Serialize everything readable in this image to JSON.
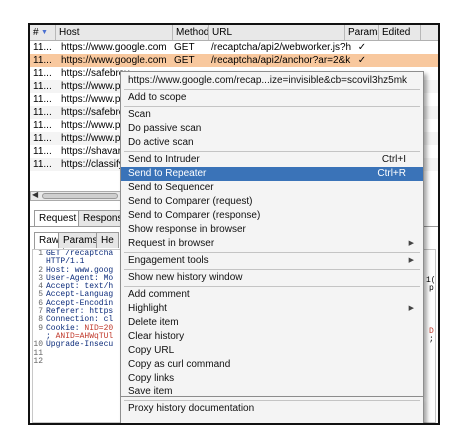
{
  "table": {
    "sort_arrow": "▼",
    "columns": [
      "#",
      "Host",
      "Method",
      "URL",
      "Params",
      "Edited"
    ],
    "rows": [
      {
        "num": "11...",
        "host": "https://www.google.com",
        "method": "GET",
        "url": "/recaptcha/api2/webworker.js?hl...",
        "params": "✓"
      },
      {
        "num": "11...",
        "host": "https://www.google.com",
        "method": "GET",
        "url": "/recaptcha/api2/anchor?ar=2&k...",
        "params": "✓"
      },
      {
        "num": "11...",
        "host": "https://safebrov",
        "method": "",
        "url": "",
        "params": ""
      },
      {
        "num": "11...",
        "host": "https://www.pin",
        "method": "",
        "url": "",
        "params": ""
      },
      {
        "num": "11...",
        "host": "https://www.pin",
        "method": "",
        "url": "",
        "params": ""
      },
      {
        "num": "11...",
        "host": "https://safebrov",
        "method": "",
        "url": "",
        "params": ""
      },
      {
        "num": "11...",
        "host": "https://www.pin",
        "method": "",
        "url": "",
        "params": ""
      },
      {
        "num": "11...",
        "host": "https://www.pin",
        "method": "",
        "url": "",
        "params": ""
      },
      {
        "num": "11...",
        "host": "https://shavar.s",
        "method": "",
        "url": "",
        "params": ""
      },
      {
        "num": "11...",
        "host": "https://classify-",
        "method": "",
        "url": "",
        "params": ""
      }
    ]
  },
  "tabs": {
    "outer": [
      "Request",
      "Response"
    ],
    "inner": [
      "Raw",
      "Params",
      "He"
    ]
  },
  "editor": {
    "line_numbers": [
      "1",
      "2",
      "3",
      "4",
      "5",
      "6",
      "7",
      "8",
      "9",
      "10",
      "11",
      "12"
    ],
    "lines": [
      "GET /recaptcha",
      "HTTP/1.1",
      "Host: www.goog",
      "User-Agent: Mo",
      "Accept: text/h",
      "Accept-Languag",
      "Accept-Encodin",
      "Referer: https",
      "Connection: cl",
      "Cookie: NID=20",
      "; ANID=AHWqTUl",
      "Upgrade-Insecu",
      "",
      ""
    ],
    "cookie_prefix": "Cookie: ",
    "cookie_value": "NID=20",
    "anid_prefix": "; ",
    "anid_value": "ANID=AHWqTUl",
    "right_fragments": [
      "1(",
      "p",
      "D",
      ";"
    ]
  },
  "context_menu": {
    "items": [
      {
        "label": "https://www.google.com/recap...ize=invisible&cb=scovil3hz5mk",
        "shortcut": "",
        "submenu": false
      },
      {
        "label": "Add to scope",
        "shortcut": "",
        "submenu": false
      },
      {
        "label": "Scan",
        "shortcut": "",
        "submenu": false
      },
      {
        "label": "Do passive scan",
        "shortcut": "",
        "submenu": false
      },
      {
        "label": "Do active scan",
        "shortcut": "",
        "submenu": false
      },
      {
        "label": "Send to Intruder",
        "shortcut": "Ctrl+I",
        "submenu": false
      },
      {
        "label": "Send to Repeater",
        "shortcut": "Ctrl+R",
        "submenu": false,
        "highlighted": true
      },
      {
        "label": "Send to Sequencer",
        "shortcut": "",
        "submenu": false
      },
      {
        "label": "Send to Comparer (request)",
        "shortcut": "",
        "submenu": false
      },
      {
        "label": "Send to Comparer (response)",
        "shortcut": "",
        "submenu": false
      },
      {
        "label": "Show response in browser",
        "shortcut": "",
        "submenu": false
      },
      {
        "label": "Request in browser",
        "shortcut": "",
        "submenu": true
      },
      {
        "label": "Engagement tools",
        "shortcut": "",
        "submenu": true
      },
      {
        "label": "Show new history window",
        "shortcut": "",
        "submenu": false
      },
      {
        "label": "Add comment",
        "shortcut": "",
        "submenu": false
      },
      {
        "label": "Highlight",
        "shortcut": "",
        "submenu": true
      },
      {
        "label": "Delete item",
        "shortcut": "",
        "submenu": false
      },
      {
        "label": "Clear history",
        "shortcut": "",
        "submenu": false
      },
      {
        "label": "Copy URL",
        "shortcut": "",
        "submenu": false
      },
      {
        "label": "Copy as curl command",
        "shortcut": "",
        "submenu": false
      },
      {
        "label": "Copy links",
        "shortcut": "",
        "submenu": false
      },
      {
        "label": "Save item",
        "shortcut": "",
        "submenu": false
      },
      {
        "label": "Proxy history documentation",
        "shortcut": "",
        "submenu": false
      }
    ],
    "submenu_arrow": "▶"
  },
  "colors": {
    "selected_row": "#f8c89e",
    "menu_highlight": "#3a73b8",
    "cookie_value": "#c0392b"
  }
}
